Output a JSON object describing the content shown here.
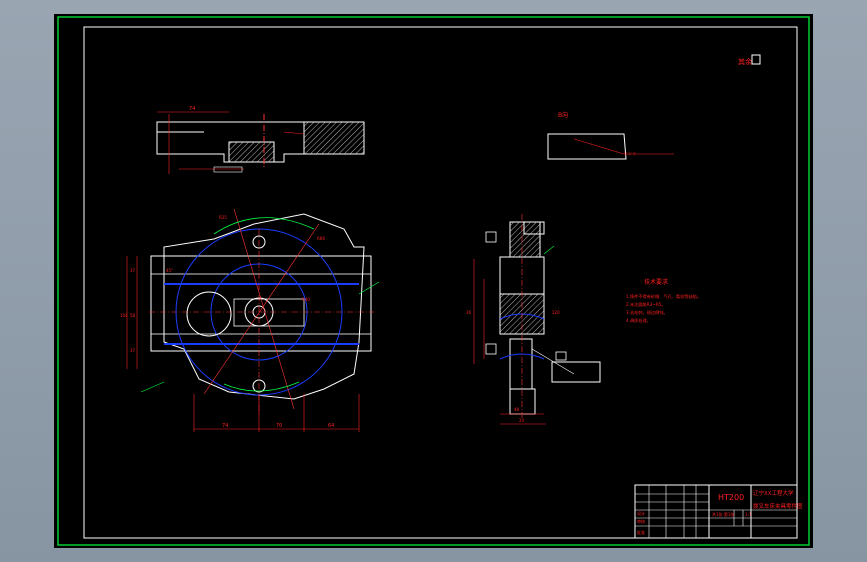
{
  "title_block": {
    "material": "HT200",
    "school": "辽宁XX工程大学",
    "drawing_name": "拨叉车床夹具零件图",
    "scale": "1:1",
    "sheet": "共1张 第1张",
    "designer": "设计",
    "checker": "审核",
    "approver": "批准"
  },
  "roughness_note": "其余",
  "section_label": "B向",
  "tech_req": {
    "title": "技术要求",
    "lines": [
      "1.铸件不得有砂眼、气孔、裂纹等缺陷。",
      "2.未注圆角R3~R5。",
      "3.去毛刺，锐边倒钝。",
      "4.调质处理。"
    ]
  },
  "dimensions": {
    "front_total_width": "74",
    "front_height": "96",
    "plan_dims": [
      "74",
      "70",
      "64"
    ],
    "left_heights": [
      "37",
      "58",
      "104",
      "37"
    ],
    "angle": "45°",
    "radius_labels": [
      "R66",
      "R40",
      "R25"
    ],
    "side_dims": [
      "48",
      "20",
      "16",
      "120"
    ]
  },
  "colors": {
    "sheet_bg": "#000000",
    "frame": "#00cc33",
    "outline": "#ffffff",
    "dimension": "#ff2020",
    "center": "#ff3333",
    "hidden": "#1a3cff",
    "note": "#00ff44"
  }
}
